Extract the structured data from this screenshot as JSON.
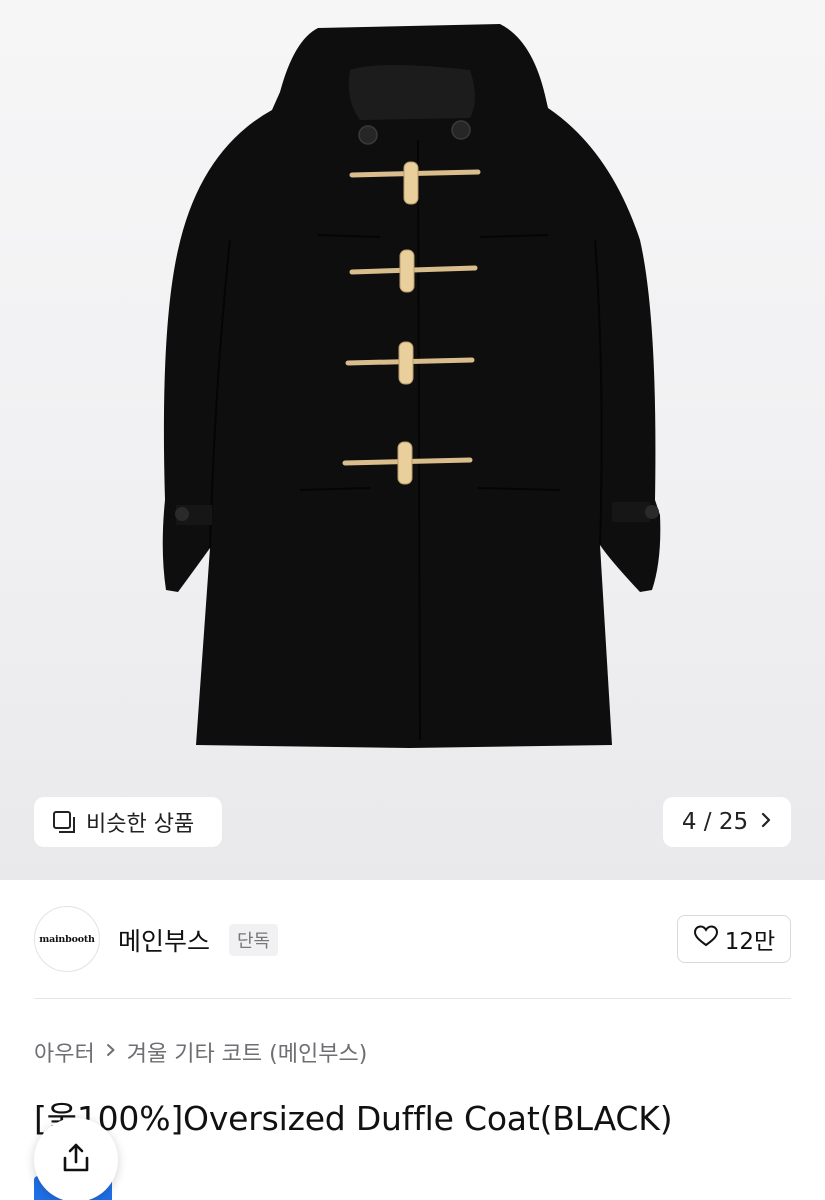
{
  "gallery": {
    "similar_label": "비슷한 상품",
    "current_image": "4",
    "separator": "/",
    "total_images": "25",
    "next_icon": "chevron-right-icon"
  },
  "brand": {
    "logo_text": "mainbooth",
    "name": "메인부스",
    "badge": "단독",
    "like_count": "12만"
  },
  "breadcrumb": {
    "level1": "아우터",
    "level2": "겨울 기타 코트 (메인부스)"
  },
  "product": {
    "title": "[울100%]Oversized Duffle Coat(BLACK)"
  },
  "colors": {
    "accent_blue": "#1f6fe5",
    "coat": "#0e0e0e",
    "toggle": "#e9cf9c"
  }
}
